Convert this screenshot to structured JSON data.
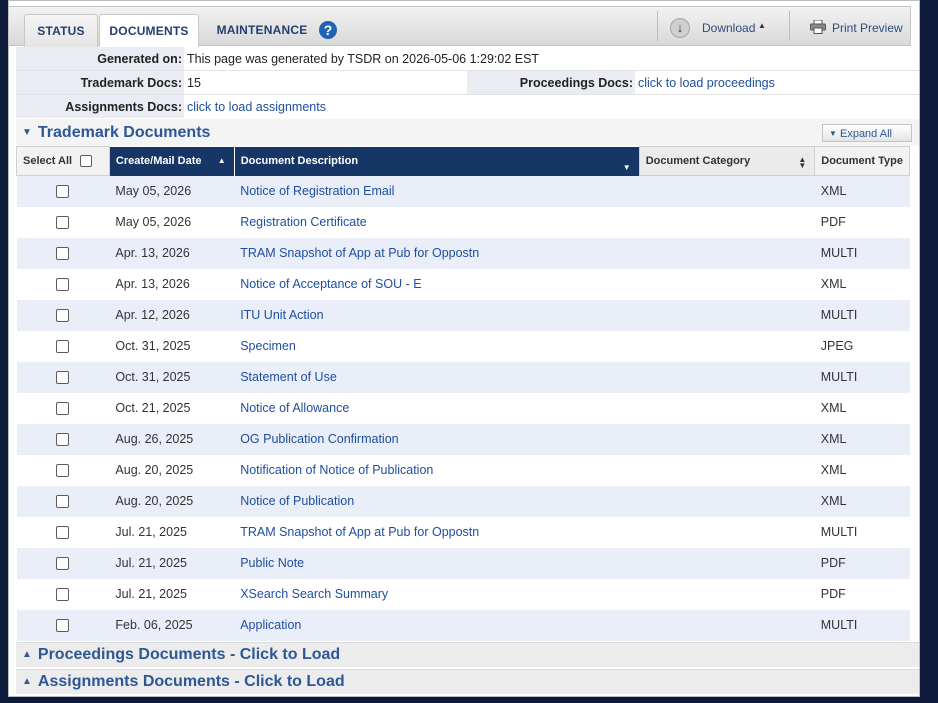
{
  "tabs": [
    "STATUS",
    "DOCUMENTS",
    "MAINTENANCE"
  ],
  "help_icon": "?",
  "toolbar": {
    "download_label": "Download",
    "print_label": "Print Preview"
  },
  "info": {
    "generated_on_label": "Generated on:",
    "generated_on_value": "This page was generated by TSDR on 2026-05-06 1:29:02 EST",
    "trademark_docs_label": "Trademark Docs:",
    "trademark_docs_value": "15",
    "proceedings_docs_label": "Proceedings Docs:",
    "proceedings_docs_value": "click to load proceedings",
    "assignments_docs_label": "Assignments Docs:",
    "assignments_docs_value": "click to load assignments"
  },
  "trademark_section": {
    "title": "Trademark Documents",
    "expand_all": "Expand All"
  },
  "table": {
    "headers": {
      "select_all": "Select All",
      "date": "Create/Mail Date",
      "description": "Document Description",
      "category": "Document Category",
      "type": "Document Type"
    },
    "rows": [
      {
        "date": "May 05, 2026",
        "description": "Notice of Registration Email",
        "category": "",
        "type": "XML"
      },
      {
        "date": "May 05, 2026",
        "description": "Registration Certificate",
        "category": "",
        "type": "PDF"
      },
      {
        "date": "Apr. 13, 2026",
        "description": "TRAM Snapshot of App at Pub for Oppostn",
        "category": "",
        "type": "MULTI"
      },
      {
        "date": "Apr. 13, 2026",
        "description": "Notice of Acceptance of SOU - E",
        "category": "",
        "type": "XML"
      },
      {
        "date": "Apr. 12, 2026",
        "description": "ITU Unit Action",
        "category": "",
        "type": "MULTI"
      },
      {
        "date": "Oct. 31, 2025",
        "description": "Specimen",
        "category": "",
        "type": "JPEG"
      },
      {
        "date": "Oct. 31, 2025",
        "description": "Statement of Use",
        "category": "",
        "type": "MULTI"
      },
      {
        "date": "Oct. 21, 2025",
        "description": "Notice of Allowance",
        "category": "",
        "type": "XML"
      },
      {
        "date": "Aug. 26, 2025",
        "description": "OG Publication Confirmation",
        "category": "",
        "type": "XML"
      },
      {
        "date": "Aug. 20, 2025",
        "description": "Notification of Notice of Publication",
        "category": "",
        "type": "XML"
      },
      {
        "date": "Aug. 20, 2025",
        "description": "Notice of Publication",
        "category": "",
        "type": "XML"
      },
      {
        "date": "Jul. 21, 2025",
        "description": "TRAM Snapshot of App at Pub for Oppostn",
        "category": "",
        "type": "MULTI"
      },
      {
        "date": "Jul. 21, 2025",
        "description": "Public Note",
        "category": "",
        "type": "PDF"
      },
      {
        "date": "Jul. 21, 2025",
        "description": "XSearch Search Summary",
        "category": "",
        "type": "PDF"
      },
      {
        "date": "Feb. 06, 2025",
        "description": "Application",
        "category": "",
        "type": "MULTI"
      }
    ]
  },
  "proceedings_section": {
    "title": "Proceedings Documents - Click to Load"
  },
  "assignments_section": {
    "title": "Assignments Documents - Click to Load"
  },
  "colors": {
    "header_navy": "#163766",
    "link_blue": "#1f4fa0",
    "row_stripe": "#e9eef8",
    "page_bg": "#0d1a3a"
  }
}
